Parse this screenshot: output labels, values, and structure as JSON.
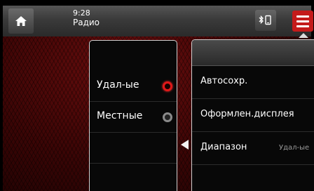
{
  "status_bar": {
    "time": "9:28",
    "mode": "Радио",
    "icons": [
      "home-icon",
      "bluetooth-phone-icon",
      "menu-icon"
    ]
  },
  "band_panel": {
    "options": [
      {
        "label": "Удал-ые",
        "selected": true
      },
      {
        "label": "Местные",
        "selected": false
      }
    ]
  },
  "settings_menu": {
    "items": [
      {
        "label": "Автосохр.",
        "value": ""
      },
      {
        "label": "Оформлен.дисплея",
        "value": ""
      },
      {
        "label": "Диапазон",
        "value": "Удал-ые"
      }
    ]
  },
  "colors": {
    "accent": "#c41b1b",
    "background": "#3a0505",
    "panel": "#080808"
  }
}
